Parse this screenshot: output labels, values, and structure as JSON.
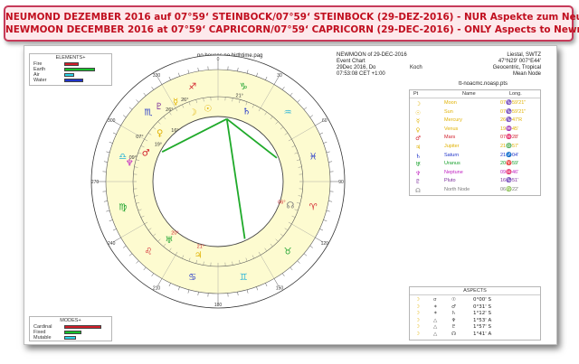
{
  "banner": {
    "line1": "NEUMOND DEZEMBER 2016 auf 07°59‘ STEINBOCK/07°59‘ STEINBOCK (29-DEZ-2016) - NUR Aspekte zum Neumond",
    "line2": "NEWMOON DECEMBER 2016 at 07°59‘ CAPRICORN/07°59‘ CAPRICORN (29-DEC-2016) - ONLY Aspects to Newmoon"
  },
  "wheel_title": "no houses.no birthtime.pag",
  "chart_info": {
    "name": "NEWMOON of 29-DEC-2016",
    "type": "Event Chart",
    "date": "29Dec 2016, Do",
    "time": "07:53:08 CET +1:00",
    "place": "Liestal, SWTZ",
    "coords": "47°N29' 007°E44'",
    "zodiac": "Geocentric, Tropical",
    "node": "Mean Node",
    "observer": "Koch",
    "point_file": "tt-noacmc.noasp.pts"
  },
  "elements": {
    "title": "ELEMENTS+",
    "rows": [
      {
        "label": "Fire",
        "value": 0.32,
        "color": "#d11e2a"
      },
      {
        "label": "Earth",
        "value": 0.68,
        "color": "#17c02b"
      },
      {
        "label": "Air",
        "value": 0.22,
        "color": "#2bd4e8"
      },
      {
        "label": "Water",
        "value": 0.42,
        "color": "#1f33c9"
      }
    ]
  },
  "modes": {
    "title": "MODES+",
    "rows": [
      {
        "label": "Cardinal",
        "value": 0.82,
        "color": "#d11e2a"
      },
      {
        "label": "Fixed",
        "value": 0.38,
        "color": "#17c02b"
      },
      {
        "label": "Mutable",
        "value": 0.26,
        "color": "#2bd4e8"
      }
    ]
  },
  "planet_table": {
    "headers": {
      "pt": "Pt",
      "name": "Name",
      "long": "Long."
    },
    "rows": [
      {
        "glyph": "☽",
        "name": "Moon",
        "long": "07♑59'21\"",
        "color": "#e0b100"
      },
      {
        "glyph": "☉",
        "name": "Sun",
        "long": "07♑59'21\"",
        "color": "#e0b100"
      },
      {
        "glyph": "☿",
        "name": "Mercury",
        "long": "26♑47'R",
        "color": "#e0b100"
      },
      {
        "glyph": "♀",
        "name": "Venus",
        "long": "19♒45'",
        "color": "#e0b100"
      },
      {
        "glyph": "♂",
        "name": "Mars",
        "long": "07♓28'",
        "color": "#d11e2a"
      },
      {
        "glyph": "♃",
        "name": "Jupiter",
        "long": "21♎57'",
        "color": "#e0b100"
      },
      {
        "glyph": "♄",
        "name": "Saturn",
        "long": "21♐04'",
        "color": "#1f33c9"
      },
      {
        "glyph": "♅",
        "name": "Uranus",
        "long": "20♈59'",
        "color": "#17a02b"
      },
      {
        "glyph": "♆",
        "name": "Neptune",
        "long": "09♓46'",
        "color": "#c020c0"
      },
      {
        "glyph": "♇",
        "name": "Pluto",
        "long": "16♑51'",
        "color": "#7a2a9a"
      },
      {
        "glyph": "☊",
        "name": "North Node",
        "long": "06♍22'",
        "color": "#7a7a7a"
      }
    ]
  },
  "aspects": {
    "title": "ASPECTS",
    "rows": [
      {
        "p1": "☽",
        "asp": "σ",
        "p2": "☉",
        "orb": "0°00' S"
      },
      {
        "p1": "☽",
        "asp": "✶",
        "p2": "♂",
        "orb": "0°31' S"
      },
      {
        "p1": "☽",
        "asp": "✶",
        "p2": "♄",
        "orb": "1°12' S"
      },
      {
        "p1": "☽",
        "asp": "△",
        "p2": "♆",
        "orb": "1°53' A"
      },
      {
        "p1": "☽",
        "asp": "△",
        "p2": "♇",
        "orb": "1°57' S"
      },
      {
        "p1": "☽",
        "asp": "△",
        "p2": "☊",
        "orb": "1°41' A"
      }
    ]
  },
  "wheel": {
    "ticks": [
      "0",
      "30",
      "60",
      "90",
      "120",
      "150",
      "180",
      "210",
      "240",
      "270",
      "300",
      "330"
    ],
    "degree_labels": [
      "16°",
      "26°",
      "07°",
      "09°",
      "19°",
      "26°",
      "21°",
      "06°",
      "21°",
      "20°"
    ],
    "zodiac_glyphs": [
      "♑",
      "♒",
      "♓",
      "♈",
      "♉",
      "♊",
      "♋",
      "♌",
      "♍",
      "♎",
      "♏",
      "♐"
    ],
    "planet_glyphs": [
      "☽",
      "☉",
      "☿",
      "♀",
      "♂",
      "♃",
      "♄",
      "♅",
      "♆",
      "♇",
      "☊"
    ]
  }
}
